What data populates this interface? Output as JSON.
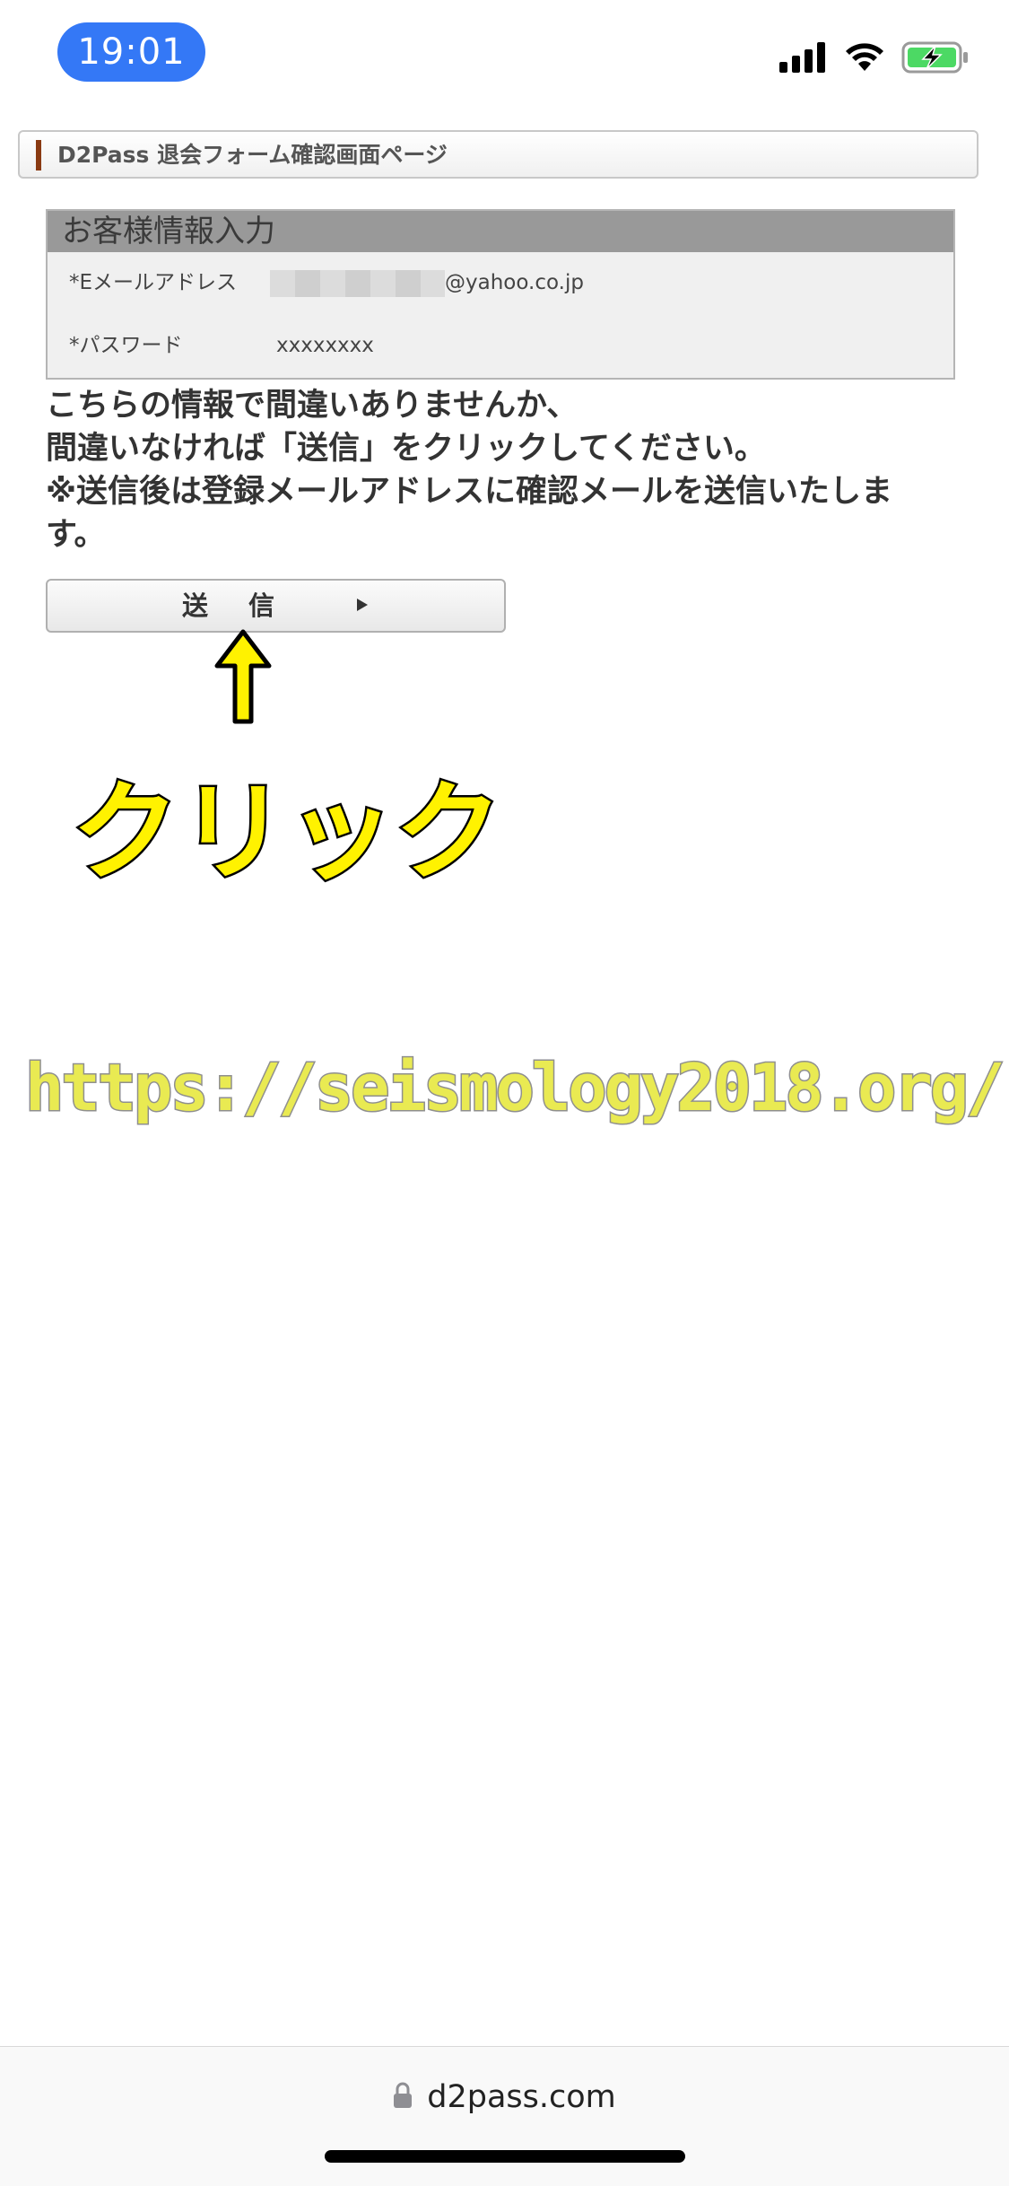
{
  "status_bar": {
    "time": "19:01",
    "icons": [
      "cellular-signal-icon",
      "wifi-icon",
      "battery-charging-icon"
    ]
  },
  "page_header": {
    "title": "D2Pass 退会フォーム確認画面ページ",
    "accent_color": "#8a3a12"
  },
  "form": {
    "section_title": "お客様情報入力",
    "email_label": "*Eメールアドレス",
    "email_domain": "@yahoo.co.jp",
    "password_label": "*パスワード",
    "password_value": "xxxxxxxx"
  },
  "message": {
    "line1": "こちらの情報で間違いありませんか、",
    "line2": "間違いなければ「送信」をクリックしてください。",
    "line3": "※送信後は登録メールアドレスに確認メールを送信いたしま",
    "line4": "す。"
  },
  "submit_button": {
    "label": "送信"
  },
  "annotation": {
    "arrow_color": "#fff200",
    "click_text": "クリック",
    "watermark": "https://seismology2018.org/"
  },
  "browser": {
    "url": "d2pass.com",
    "lock_icon": "lock-icon"
  }
}
